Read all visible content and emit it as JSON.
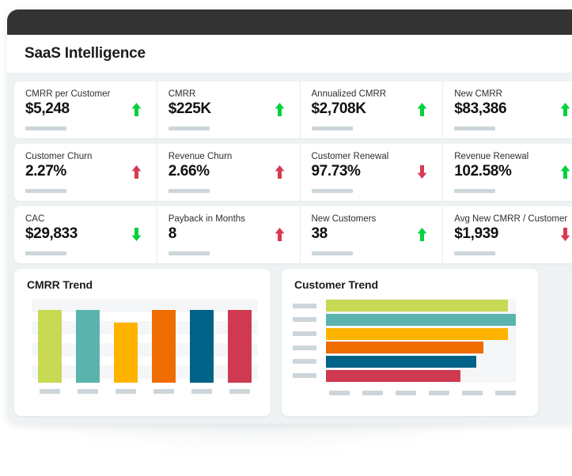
{
  "window": {
    "titlebar_color": "#333333",
    "background_color": "#eef2f3"
  },
  "header": {
    "title": "SaaS Intelligence"
  },
  "kpi_rows": [
    {
      "cells": [
        {
          "label": "CMRR per Customer",
          "value": "$5,248",
          "trend": "up",
          "trend_color": "#00d13c"
        },
        {
          "label": "CMRR",
          "value": "$225K",
          "trend": "up",
          "trend_color": "#00d13c"
        },
        {
          "label": "Annualized CMRR",
          "value": "$2,708K",
          "trend": "up",
          "trend_color": "#00d13c"
        },
        {
          "label": "New CMRR",
          "value": "$83,386",
          "trend": "up",
          "trend_color": "#00d13c"
        }
      ]
    },
    {
      "cells": [
        {
          "label": "Customer Churn",
          "value": "2.27%",
          "trend": "up",
          "trend_color": "#d83a52"
        },
        {
          "label": "Revenue Churn",
          "value": "2.66%",
          "trend": "up",
          "trend_color": "#d83a52"
        },
        {
          "label": "Customer Renewal",
          "value": "97.73%",
          "trend": "down",
          "trend_color": "#d83a52"
        },
        {
          "label": "Revenue Renewal",
          "value": "102.58%",
          "trend": "up",
          "trend_color": "#00d13c"
        }
      ]
    },
    {
      "cells": [
        {
          "label": "CAC",
          "value": "$29,833",
          "trend": "down",
          "trend_color": "#00d13c"
        },
        {
          "label": "Payback in Months",
          "value": "8",
          "trend": "up",
          "trend_color": "#d83a52"
        },
        {
          "label": "New Customers",
          "value": "38",
          "trend": "up",
          "trend_color": "#00d13c"
        },
        {
          "label": "Avg New CMRR / Customer",
          "value": "$1,939",
          "trend": "down",
          "trend_color": "#d83a52"
        }
      ]
    }
  ],
  "charts": [
    {
      "title": "CMRR Trend",
      "chart_data": {
        "type": "bar",
        "title": "CMRR Trend",
        "orientation": "vertical",
        "xlabel": "",
        "ylabel": "",
        "grid": true,
        "legend": false,
        "categories": [
          "",
          "",
          "",
          "",
          "",
          ""
        ],
        "tick_labels_hidden": true,
        "values": [
          100,
          100,
          83,
          100,
          100,
          100
        ],
        "ylim": [
          0,
          115
        ],
        "colors": [
          "#c8d953",
          "#5bb3ad",
          "#ffb300",
          "#ef6c00",
          "#016287",
          "#cf3a50"
        ]
      }
    },
    {
      "title": "Customer Trend",
      "chart_data": {
        "type": "bar",
        "title": "Customer Trend",
        "orientation": "horizontal",
        "xlabel": "",
        "ylabel": "",
        "grid": false,
        "legend": false,
        "categories": [
          "",
          "",
          "",
          "",
          "",
          ""
        ],
        "tick_labels_hidden": true,
        "values": [
          96,
          100,
          96,
          83,
          79,
          71
        ],
        "xlim": [
          0,
          100
        ],
        "colors": [
          "#c8d953",
          "#5bb3ad",
          "#ffb300",
          "#ef6c00",
          "#016287",
          "#cf3a50"
        ]
      }
    }
  ]
}
